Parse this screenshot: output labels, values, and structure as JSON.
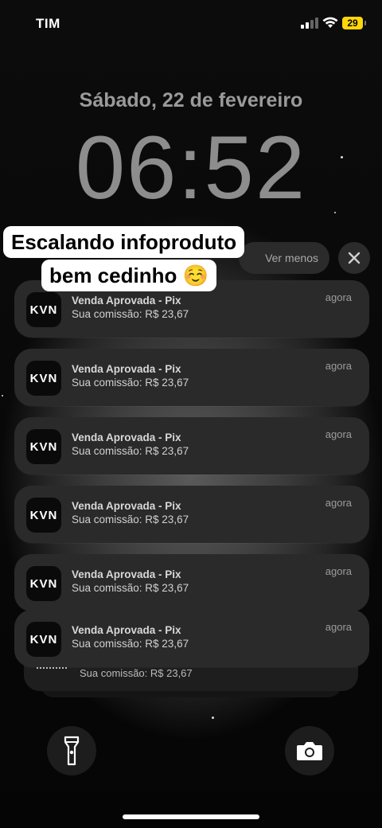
{
  "status_bar": {
    "carrier": "TIM",
    "battery": "29"
  },
  "lock_screen": {
    "date": "Sábado, 22 de fevereiro",
    "time": "06:52"
  },
  "controls": {
    "show_less_label": "Ver menos"
  },
  "caption": {
    "line1": "Escalando infoproduto",
    "line2": "bem cedinho ☺️"
  },
  "notifications": [
    {
      "app": "KVN",
      "title": "Venda Aprovada - Pix",
      "body": "Sua comissão: R$ 23,67",
      "time": "agora"
    },
    {
      "app": "KVN",
      "title": "Venda Aprovada - Pix",
      "body": "Sua comissão: R$ 23,67",
      "time": "agora"
    },
    {
      "app": "KVN",
      "title": "Venda Aprovada - Pix",
      "body": "Sua comissão: R$ 23,67",
      "time": "agora"
    },
    {
      "app": "KVN",
      "title": "Venda Aprovada - Pix",
      "body": "Sua comissão: R$ 23,67",
      "time": "agora"
    },
    {
      "app": "KVN",
      "title": "Venda Aprovada - Pix",
      "body": "Sua comissão: R$ 23,67",
      "time": "agora"
    },
    {
      "app": "KVN",
      "title": "Venda Aprovada - Pix",
      "body": "Sua comissão: R$ 23,67",
      "time": "agora"
    }
  ],
  "stacked_notification": {
    "body": "Sua comissão: R$ 23,67"
  },
  "icons": {
    "flashlight": "flashlight-icon",
    "camera": "camera-icon",
    "close": "close-icon",
    "wifi": "wifi-icon"
  }
}
